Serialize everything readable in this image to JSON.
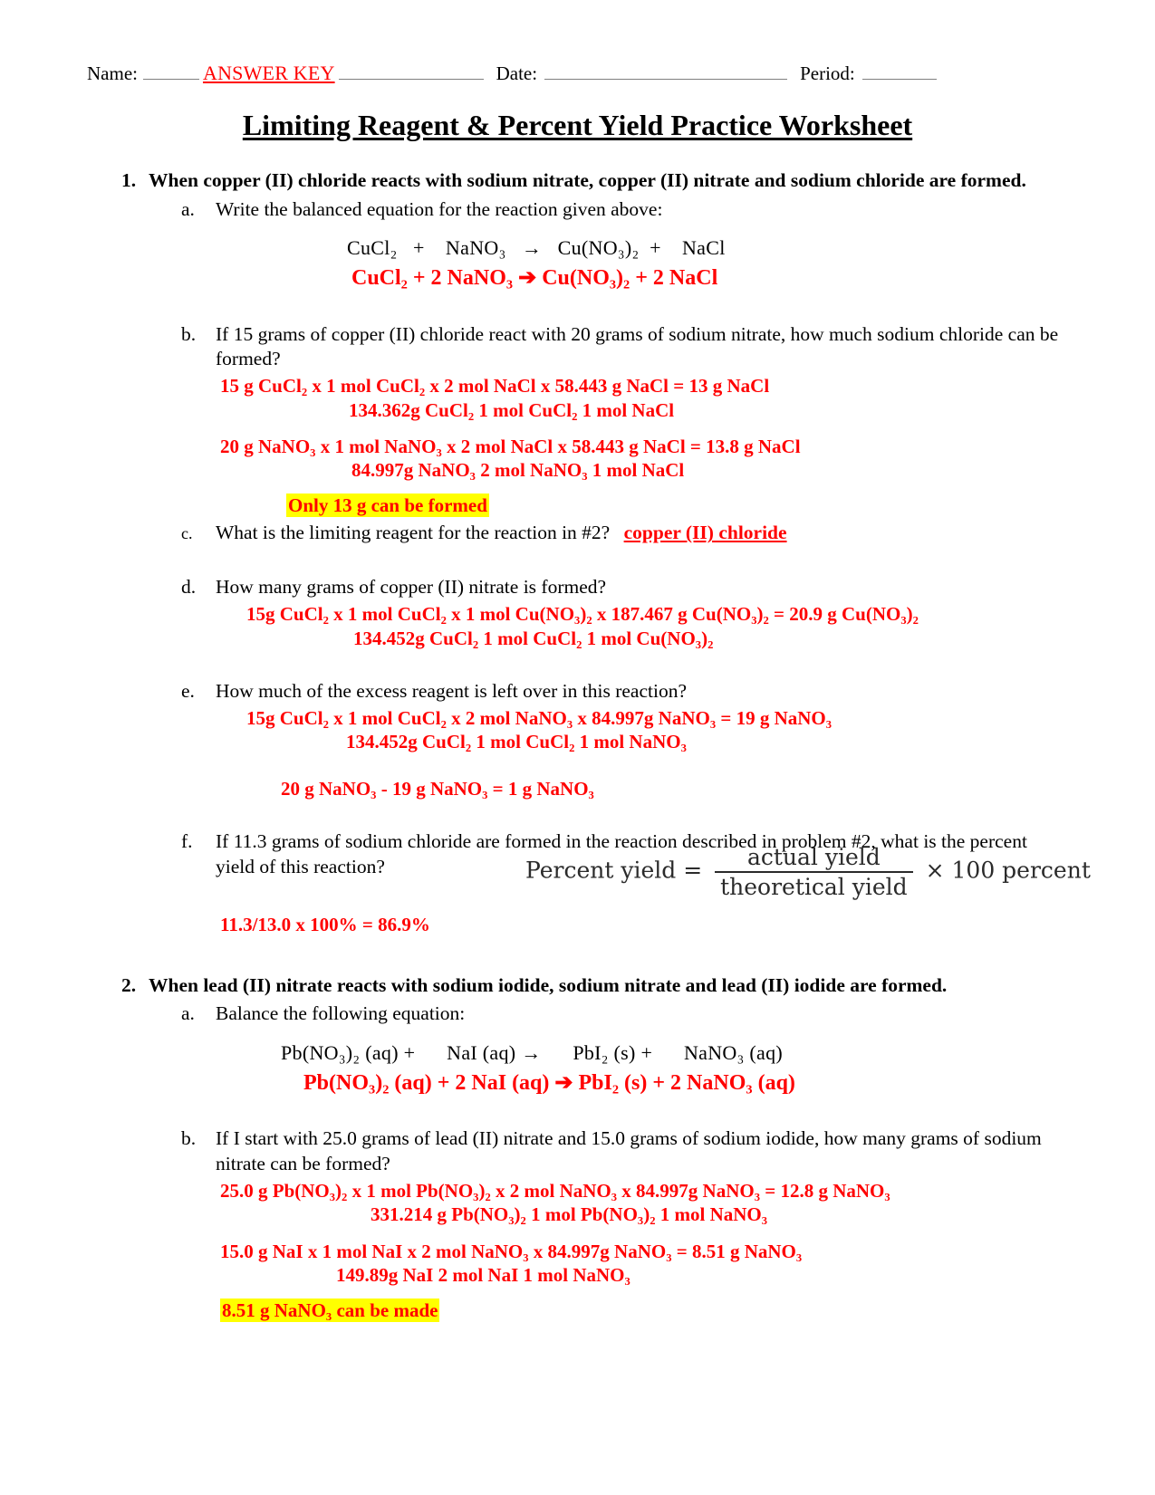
{
  "header": {
    "name_label": "Name:",
    "answer_key": "ANSWER KEY",
    "date_label": "Date:",
    "period_label": "Period:"
  },
  "title": "Limiting Reagent & Percent Yield Practice Worksheet",
  "colors": {
    "answer_red": "#ff0000",
    "highlight_yellow": "#ffff00",
    "rule_gray": "#808080"
  },
  "q1": {
    "number": "1.",
    "prompt": "When copper (II) chloride reacts with sodium nitrate, copper (II) nitrate and sodium chloride are formed.",
    "a": {
      "letter": "a.",
      "prompt": "Write the balanced equation for the reaction given above:",
      "equation_given": "CuCl₂   +    NaNO₃   →   Cu(NO₃)₂  +    NaCl",
      "equation_answer": "CuCl₂ + 2 NaNO₃ ➔ Cu(NO₃)₂ + 2 NaCl"
    },
    "b": {
      "letter": "b.",
      "prompt": "If 15 grams of copper (II) chloride react with 20 grams of sodium nitrate, how much sodium chloride can be formed?",
      "work1_top": "15 g CuCl₂ x      1 mol CuCl₂   x 2 mol NaCl x  58.443 g NaCl = 13 g NaCl",
      "work1_bottom": "134.362g CuCl₂   1 mol CuCl₂     1 mol NaCl",
      "work2_top": "20 g NaNO₃ x   1 mol NaNO₃   x  2 mol NaCl     x 58.443 g NaCl = 13.8 g NaCl",
      "work2_bottom": "84.997g NaNO₃    2 mol NaNO₃        1 mol NaCl",
      "highlight": "Only 13 g can be formed"
    },
    "c": {
      "letter": "c.",
      "prompt": "What is the limiting reagent for the reaction in #2?",
      "answer": "copper (II) chloride"
    },
    "d": {
      "letter": "d.",
      "prompt": "How many grams of copper (II) nitrate is formed?",
      "work_top": "15g CuCl₂  x  1 mol CuCl₂      x 1 mol Cu(NO₃)₂  x 187.467 g Cu(NO₃)₂  = 20.9 g Cu(NO₃)₂",
      "work_bottom": "134.452g CuCl₂     1 mol CuCl₂        1 mol Cu(NO₃)₂"
    },
    "e": {
      "letter": "e.",
      "prompt": "How much of the excess reagent is left over in this reaction?",
      "work_top": "15g CuCl₂  x  1 mol CuCl₂      x 2 mol NaNO₃  x 84.997g NaNO₃  = 19 g NaNO₃",
      "work_bottom": "134.452g CuCl₂     1 mol CuCl₂        1 mol NaNO₃",
      "subtraction": "20 g  NaNO₃  - 19 g  NaNO₃  =  1 g NaNO₃"
    },
    "f": {
      "letter": "f.",
      "prompt": "If 11.3 grams of sodium chloride are formed in the reaction described in problem #2, what is the percent yield of this reaction?",
      "formula": {
        "lhs": "Percent yield =",
        "numerator": "actual yield",
        "denominator": "theoretical yield",
        "rhs": "× 100 percent"
      },
      "answer": "11.3/13.0 x 100% = 86.9%"
    }
  },
  "q2": {
    "number": "2.",
    "prompt": "When lead (II) nitrate reacts with sodium iodide, sodium nitrate and lead (II) iodide are formed.",
    "a": {
      "letter": "a.",
      "prompt": "Balance the following equation:",
      "equation_given": "Pb(NO₃)₂ (aq) +      NaI (aq) →      PbI₂ (s) +      NaNO₃ (aq)",
      "equation_answer": "Pb(NO₃)₂ (aq) + 2 NaI (aq) ➔ PbI₂ (s) + 2 NaNO₃ (aq)"
    },
    "b": {
      "letter": "b.",
      "prompt": "If I start with 25.0 grams of lead (II) nitrate and 15.0 grams of sodium iodide, how many grams of sodium nitrate can be formed?",
      "work1_top": "25.0 g Pb(NO₃)₂ x 1 mol Pb(NO₃)₂ x   2 mol NaNO₃   x 84.997g NaNO₃ = 12.8 g NaNO₃",
      "work1_bottom": "331.214 g Pb(NO₃)₂  1 mol Pb(NO₃)₂     1 mol NaNO₃",
      "work2_top": "15.0 g NaI x 1 mol NaI x   2 mol NaNO₃ x 84.997g NaNO₃ =  8.51 g NaNO₃",
      "work2_bottom": "149.89g NaI      2 mol NaI      1 mol NaNO₃",
      "highlight": "8.51 g NaNO₃ can be made"
    }
  }
}
